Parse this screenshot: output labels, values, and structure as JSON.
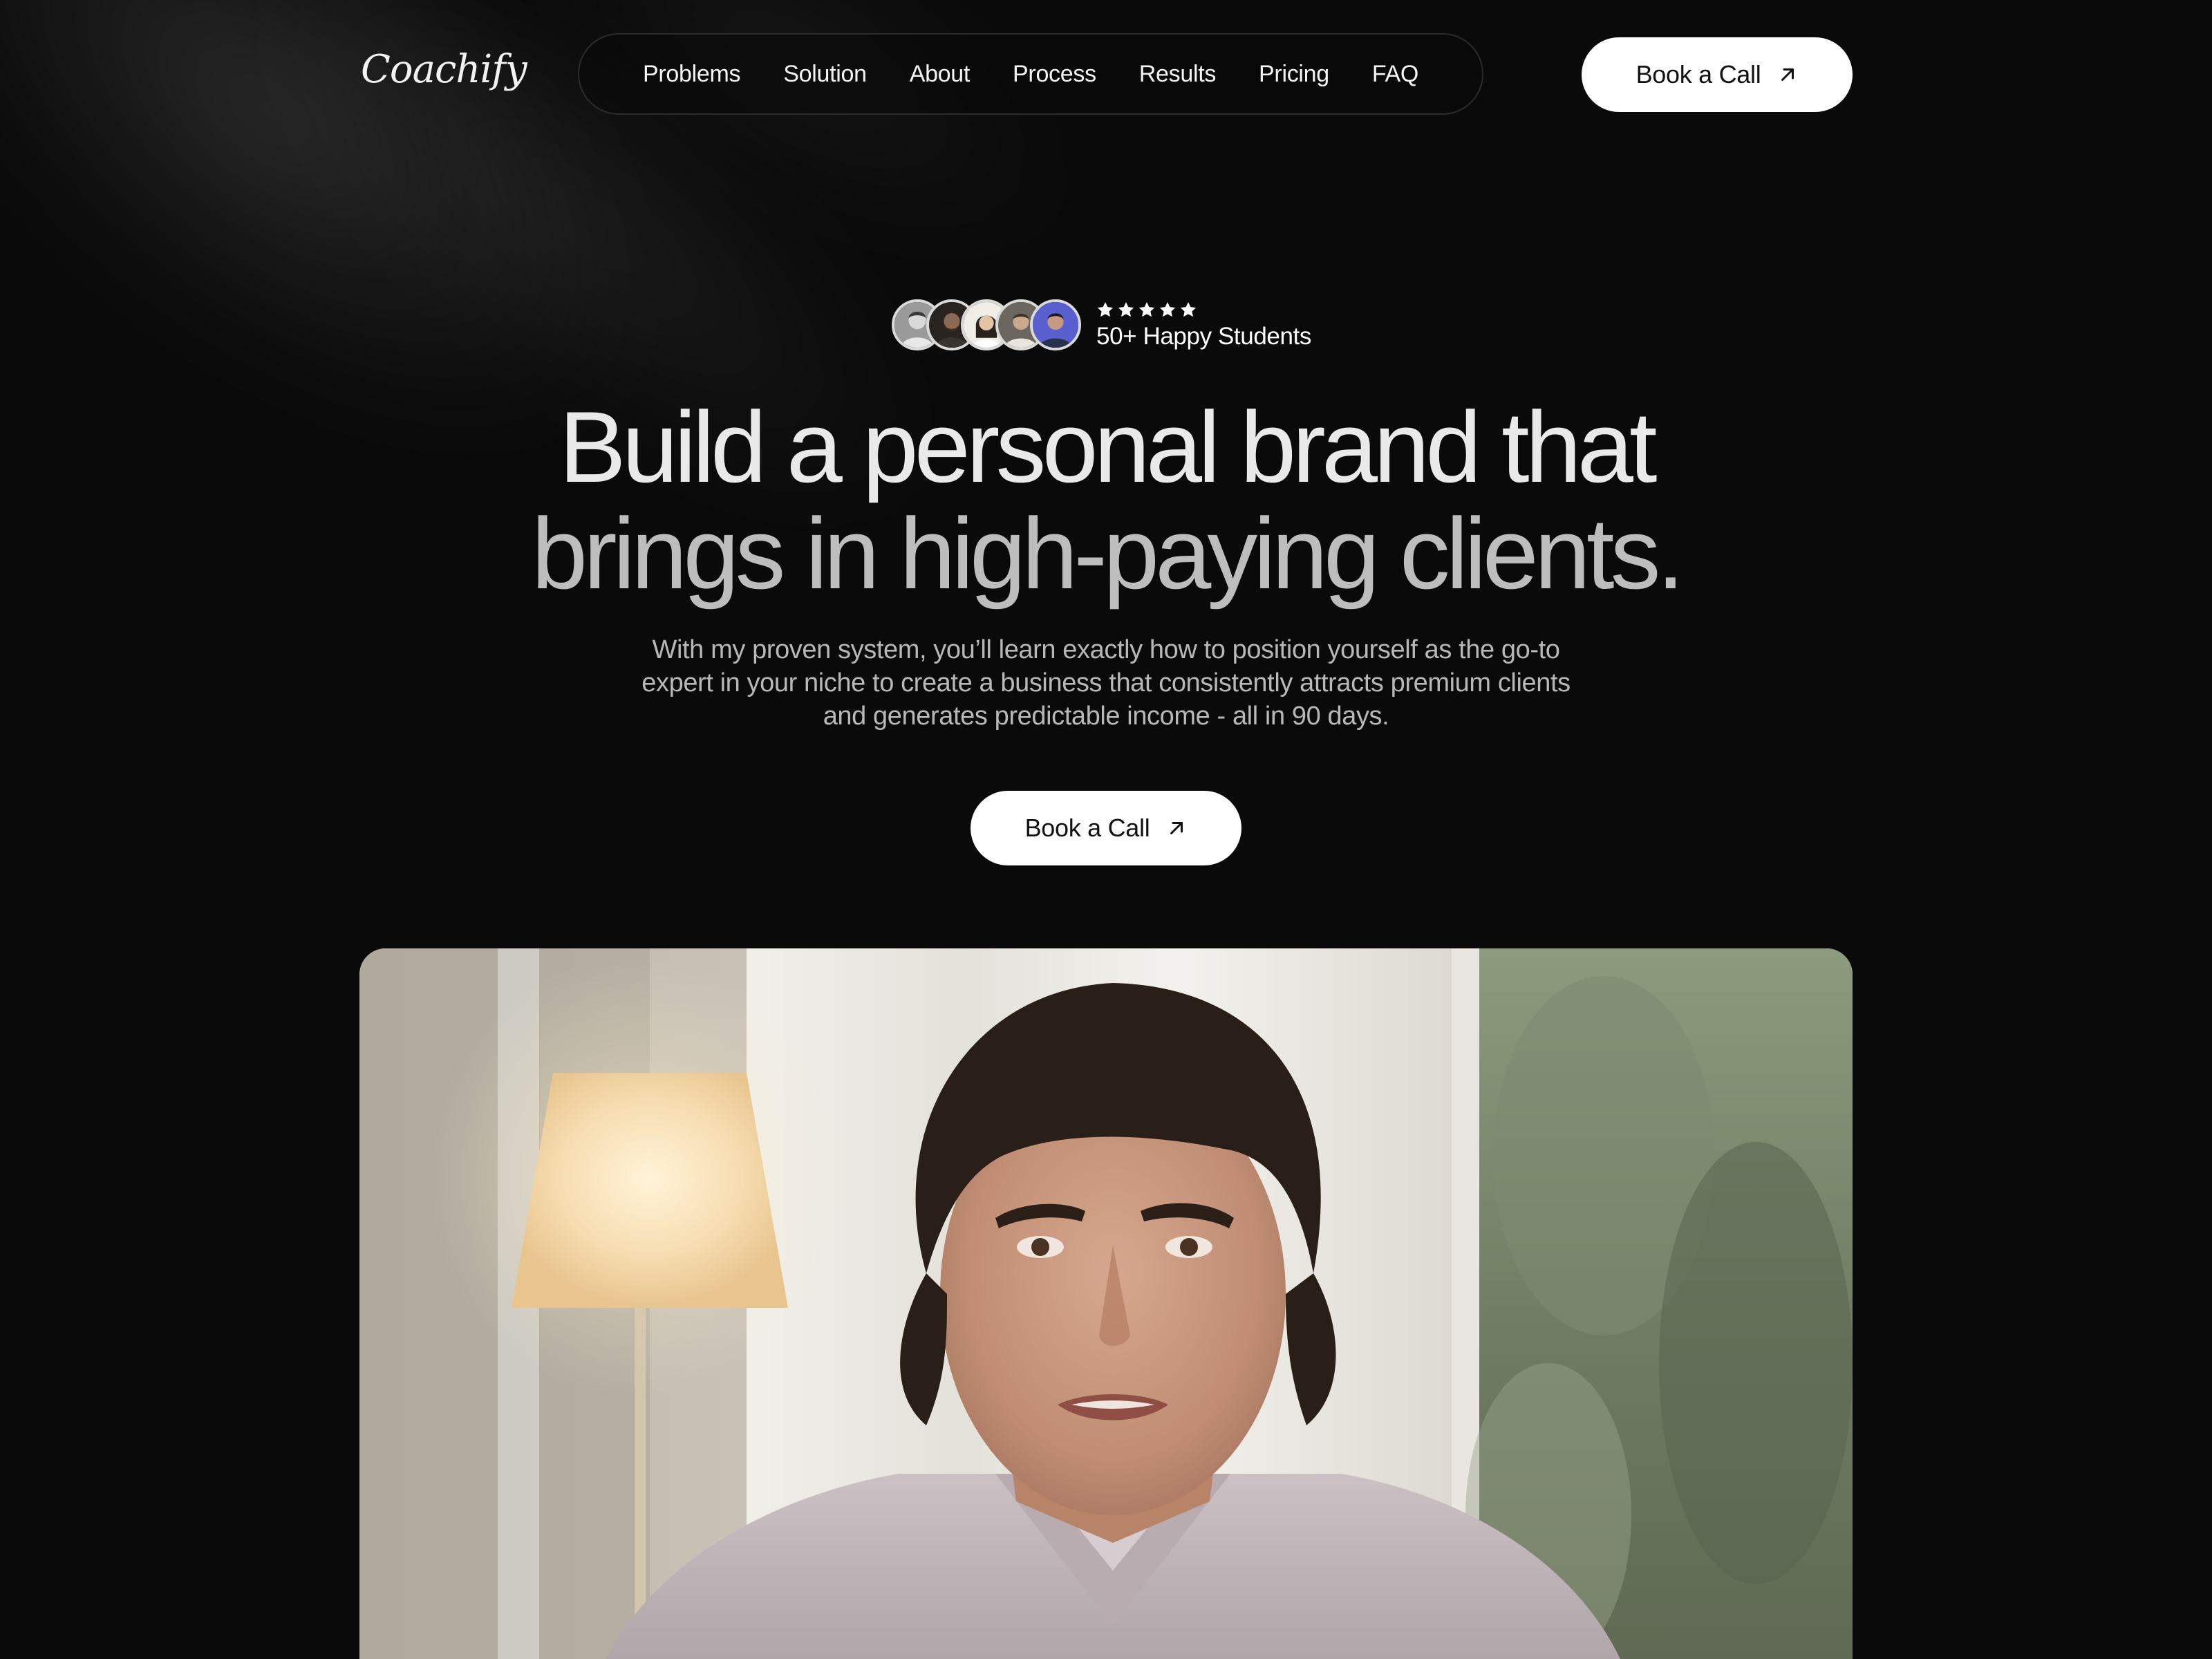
{
  "brand": {
    "logo_text": "Coachify"
  },
  "nav": {
    "items": [
      "Problems",
      "Solution",
      "About",
      "Process",
      "Results",
      "Pricing",
      "FAQ"
    ]
  },
  "header": {
    "cta_label": "Book a Call",
    "cta_icon": "arrow-up-right-icon"
  },
  "social_proof": {
    "rating_stars": 5,
    "label": "50+ Happy Students",
    "avatar_count": 5
  },
  "hero": {
    "headline_line1": "Build a personal brand that",
    "headline_line2": "brings in high-paying clients.",
    "subtext": "With my proven system, you’ll learn exactly how to position yourself as the go-to expert in your niche to create a business that consistently attracts premium clients and generates predictable income - all in 90 days.",
    "cta_label": "Book a Call",
    "cta_icon": "arrow-up-right-icon"
  },
  "video": {
    "content": "coach-portrait"
  },
  "colors": {
    "background": "#0a0a0a",
    "button_bg": "#ffffff",
    "button_text": "#111111",
    "headline_primary": "#e9e9e9",
    "headline_secondary": "#bdbdbd",
    "subtext": "#b8b8b8"
  }
}
